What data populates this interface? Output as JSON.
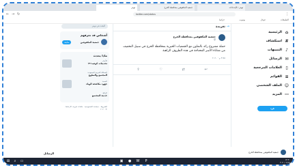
{
  "browser": {
    "tabs": [
      {
        "label": "تويتر / الإعدادات"
      },
      {
        "label": "جمعية المكفوفين بمحافظة الخرج"
      },
      {
        "label": "تويتر"
      }
    ],
    "url": "twitter.com/status"
  },
  "bookmarks": [
    "التطبيقات",
    "جوجل",
    "يوتيوب",
    "خرائط"
  ],
  "nav": {
    "items": [
      {
        "label": "الرئيسية",
        "icon": "home-icon",
        "glyph": "⌂"
      },
      {
        "label": "استكشاف",
        "icon": "hash-icon",
        "glyph": "#"
      },
      {
        "label": "التنبيهات",
        "icon": "bell-icon",
        "glyph": "♪"
      },
      {
        "label": "الرسائل",
        "icon": "mail-icon",
        "glyph": "✉"
      },
      {
        "label": "العلامات المرجعية",
        "icon": "bookmark-icon",
        "glyph": "▯"
      },
      {
        "label": "القوائم",
        "icon": "list-icon",
        "glyph": "≡"
      },
      {
        "label": "الملف الشخصي",
        "icon": "profile-icon",
        "glyph": "☺"
      },
      {
        "label": "المزيد",
        "icon": "more-icon",
        "glyph": "⋯"
      }
    ],
    "tweet_button": "غرد"
  },
  "tweet": {
    "header": "تغريدة",
    "author_name": "جمعية المكفوفين بمحافظة الخرج",
    "author_handle": "@",
    "text": "حملة مشروع رائد بالتعاون مع الجمعيات الخيرية بمحافظة الخرج في سبيل التخفيف من معاناة الأسر المحتاجة في هذه الظروف الراهنة",
    "link": "#",
    "meta": "٣:٤٥ م · ٢٠٢٠",
    "actions": [
      "↩",
      "⇄",
      "♡",
      "⇪"
    ]
  },
  "sidebar": {
    "search_placeholder": "البحث في تويتر",
    "who_to_follow": {
      "title": "أشخاص قد تعرفهم",
      "accounts": [
        {
          "name": "جمعية المكفوفين",
          "button": "متابعة"
        }
      ]
    },
    "trends": {
      "title": "ماذا يحدث",
      "items": [
        {
          "category": "الأخبار",
          "title": "تحديثات كوفيد-١٩"
        },
        {
          "category": "المملكة العربية السعودية",
          "title": "المجتمع والتطوع"
        },
        {
          "category": "الصحة",
          "title": "جهود مكافحة الوباء"
        },
        {
          "category": "الرائج",
          "title": "خدمة المجتمع"
        }
      ]
    },
    "footer": "الشروط · سياسة الخصوصية · ملفات تعريف الارتباط · © ٢٠٢٠"
  },
  "messages_label": "الرسائل",
  "account": {
    "name": "جمعية المكفوفين بمحافظة الخرج"
  },
  "taskbar": {
    "time": "١٢:٣٠",
    "date": "٢٠٢٠/٠٤/١٥"
  },
  "colors": {
    "accent": "#1da1f2",
    "frame": "#2f7fd6",
    "taskbar": "#1d2433"
  }
}
